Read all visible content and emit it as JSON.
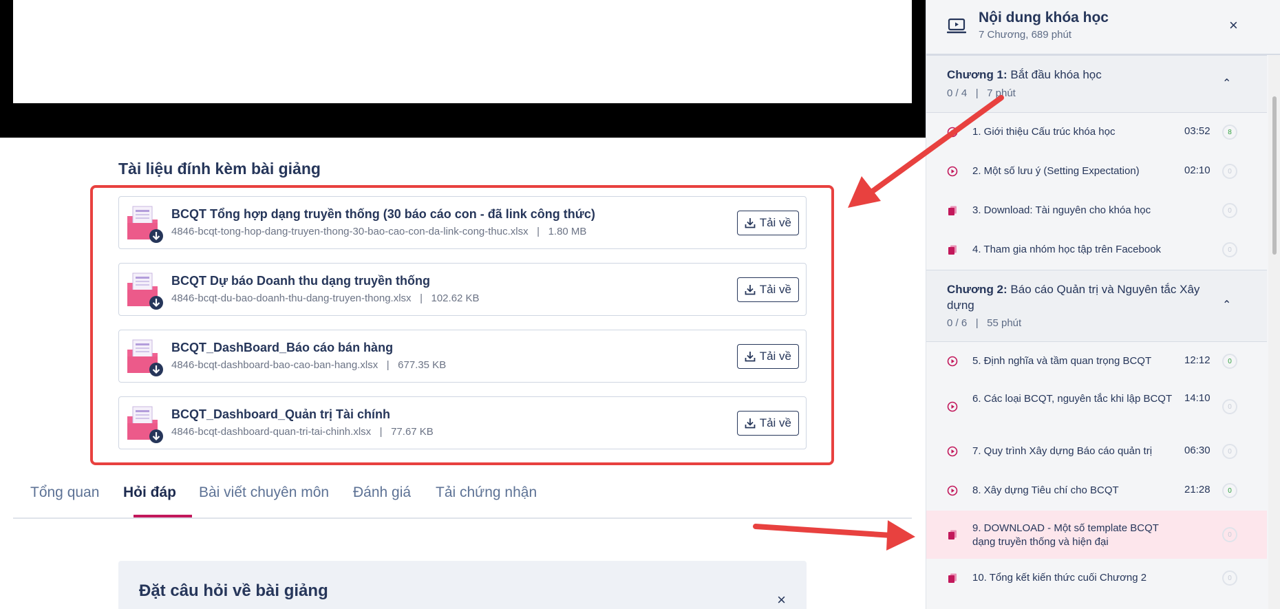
{
  "attachments": {
    "title": "Tài liệu đính kèm bài giảng",
    "download_label": "Tải về",
    "files": [
      {
        "name": "BCQT Tổng hợp dạng truyền thống (30 báo cáo con - đã link công thức)",
        "filename": "4846-bcqt-tong-hop-dang-truyen-thong-30-bao-cao-con-da-link-cong-thuc.xlsx",
        "size": "1.80 MB"
      },
      {
        "name": "BCQT Dự báo Doanh thu dạng truyền thống",
        "filename": "4846-bcqt-du-bao-doanh-thu-dang-truyen-thong.xlsx",
        "size": "102.62 KB"
      },
      {
        "name": "BCQT_DashBoard_Báo cáo bán hàng",
        "filename": "4846-bcqt-dashboard-bao-cao-ban-hang.xlsx",
        "size": "677.35 KB"
      },
      {
        "name": "BCQT_Dashboard_Quản trị Tài chính",
        "filename": "4846-bcqt-dashboard-quan-tri-tai-chinh.xlsx",
        "size": "77.67 KB"
      }
    ]
  },
  "meta_separator": "|",
  "tabs": [
    {
      "label": "Tổng quan"
    },
    {
      "label": "Hỏi đáp",
      "active": true
    },
    {
      "label": "Bài viết chuyên môn"
    },
    {
      "label": "Đánh giá"
    },
    {
      "label": "Tải chứng nhận"
    }
  ],
  "ask": {
    "title": "Đặt câu hỏi về bài giảng",
    "close": "×"
  },
  "sidebar": {
    "title": "Nội dung khóa học",
    "subtitle": "7 Chương, 689 phút",
    "close": "×",
    "chapters": [
      {
        "label": "Chương 1:",
        "name": "Bắt đầu khóa học",
        "progress": "0 / 4",
        "duration": "7 phút",
        "chevron": "⌃",
        "lessons": [
          {
            "title": "1. Giới thiệu Cấu trúc khóa học",
            "time": "03:52",
            "type": "video",
            "progress": "8",
            "green": true
          },
          {
            "title": "2. Một số lưu ý (Setting Expectation)",
            "time": "02:10",
            "type": "video",
            "progress": "0"
          },
          {
            "title": "3. Download: Tài nguyên cho khóa học",
            "time": "",
            "type": "doc",
            "progress": "0"
          },
          {
            "title": "4. Tham gia nhóm học tập trên Facebook",
            "time": "",
            "type": "doc",
            "progress": "0"
          }
        ]
      },
      {
        "label": "Chương 2:",
        "name": "Báo cáo Quản trị và Nguyên tắc Xây dựng",
        "progress": "0 / 6",
        "duration": "55 phút",
        "chevron": "⌃",
        "lessons": [
          {
            "title": "5. Định nghĩa và tầm quan trọng BCQT",
            "time": "12:12",
            "type": "video",
            "progress": "0",
            "green": true
          },
          {
            "title": "6. Các loại BCQT, nguyên tắc khi lập BCQT",
            "time": "14:10",
            "type": "video",
            "progress": "0"
          },
          {
            "title": "7. Quy trình Xây dựng Báo cáo quản trị",
            "time": "06:30",
            "type": "video",
            "progress": "0"
          },
          {
            "title": "8. Xây dựng Tiêu chí cho BCQT",
            "time": "21:28",
            "type": "video",
            "progress": "0",
            "green": true
          },
          {
            "title": "9. DOWNLOAD - Một số template BCQT dạng truyền thống và hiện đại",
            "time": "",
            "type": "doc",
            "progress": "0",
            "active": true
          },
          {
            "title": "10. Tổng kết kiến thức cuối Chương 2",
            "time": "",
            "type": "doc",
            "progress": "0"
          }
        ]
      }
    ]
  },
  "colors": {
    "accent": "#c2185b",
    "annotation": "#e8413f",
    "navy": "#26365a"
  }
}
